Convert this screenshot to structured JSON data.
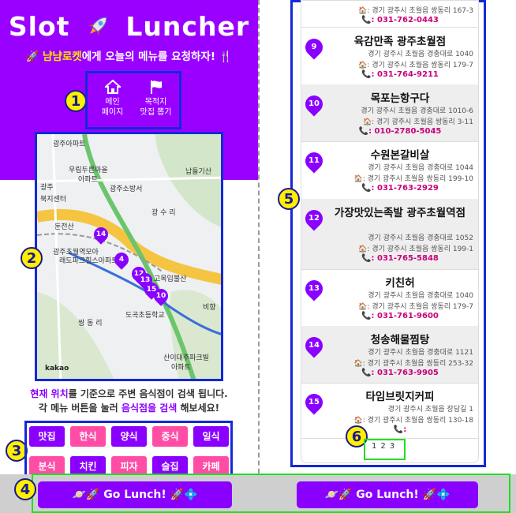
{
  "header": {
    "title_left": "Slot",
    "title_right": "Luncher",
    "subtitle_highlight": "냠냠로켓",
    "subtitle_rest": "에게 오늘의 메뉴를 요청하자!"
  },
  "nav": {
    "items": [
      {
        "label_line1": "메인",
        "label_line2": "페이지",
        "icon": "home-icon"
      },
      {
        "label_line1": "목적지",
        "label_line2": "맛집 뽑기",
        "icon": "flag-icon"
      }
    ]
  },
  "badges": [
    "1",
    "2",
    "3",
    "4",
    "5",
    "6"
  ],
  "map": {
    "labels": [
      "광주아파트",
      "우림두른마을",
      "아파트",
      "광주소방서",
      "납들기산",
      "광주",
      "북지센터",
      "광 수 리",
      "둔전산",
      "광주초월역모아",
      "래도파크힐스아파트",
      "고목입불산",
      "비향",
      "쌍 동 리",
      "도곡초등학교",
      "산이대주파크빌",
      "아파트"
    ],
    "markers": [
      "14",
      "4",
      "12",
      "13",
      "15",
      "10"
    ],
    "logo": "kakao"
  },
  "description": {
    "line1_a": "현재 위치",
    "line1_b": "를 기준으로 주변 음식점이 검색 됩니다.",
    "line2_a": "각 메뉴 버튼을 눌러 ",
    "line2_b": "음식점을 검색",
    "line2_c": " 해보세요!"
  },
  "categories": [
    {
      "label": "맛집",
      "color": "#8a00ff"
    },
    {
      "label": "한식",
      "color": "#ff4da6"
    },
    {
      "label": "양식",
      "color": "#8a00ff"
    },
    {
      "label": "중식",
      "color": "#ff4da6"
    },
    {
      "label": "일식",
      "color": "#8a00ff"
    },
    {
      "label": "분식",
      "color": "#ff4da6"
    },
    {
      "label": "치킨",
      "color": "#8a00ff"
    },
    {
      "label": "피자",
      "color": "#ff4da6"
    },
    {
      "label": "술집",
      "color": "#8a00ff"
    },
    {
      "label": "카페",
      "color": "#ff4da6"
    }
  ],
  "go_button": {
    "label": "Go Lunch!"
  },
  "list": {
    "top_partial": {
      "addr2": ": 경기 광주시 초월읍 쌍동리 167-3",
      "phone": ": 031-762-0443"
    },
    "items": [
      {
        "num": "9",
        "name": "육감만족 광주초월점",
        "addr1": "경기 광주시 초월읍 경충대로 1040",
        "addr2": ": 경기 광주시 초월읍 쌍동리 179-7",
        "phone": ": 031-764-9211"
      },
      {
        "num": "10",
        "name": "목포는항구다",
        "addr1": "경기 광주시 초월읍 경충대로 1010-6",
        "addr2": ": 경기 광주시 초월읍 쌍동리 3-11",
        "phone": ": 010-2780-5045"
      },
      {
        "num": "11",
        "name": "수원본갈비살",
        "addr1": "경기 광주시 초월읍 경충대로 1044",
        "addr2": ": 경기 광주시 초월읍 쌍동리 199-10",
        "phone": ": 031-763-2929"
      },
      {
        "num": "12",
        "name": "가장맛있는족발 광주초월역점",
        "addr1": "경기 광주시 초월읍 경충대로 1052",
        "addr2": ": 경기 광주시 초월읍 쌍동리 199-1",
        "phone": ": 031-765-5848"
      },
      {
        "num": "13",
        "name": "키친허",
        "addr1": "경기 광주시 초월읍 경충대로 1040",
        "addr2": ": 경기 광주시 초월읍 쌍동리 179-7",
        "phone": ": 031-761-9600"
      },
      {
        "num": "14",
        "name": "청송해물찜탕",
        "addr1": "경기 광주시 초월읍 경충대로 1121",
        "addr2": ": 경기 광주시 초월읍 쌍동리 253-32",
        "phone": ": 031-763-9905"
      },
      {
        "num": "15",
        "name": "타임브릿지커피",
        "addr1": "경기 광주시 초월읍 장담길 1",
        "addr2": ": 경기 광주시 초월읍 쌍동리 130-18",
        "phone": ":"
      }
    ]
  },
  "pager": [
    "1",
    "2",
    "3"
  ]
}
